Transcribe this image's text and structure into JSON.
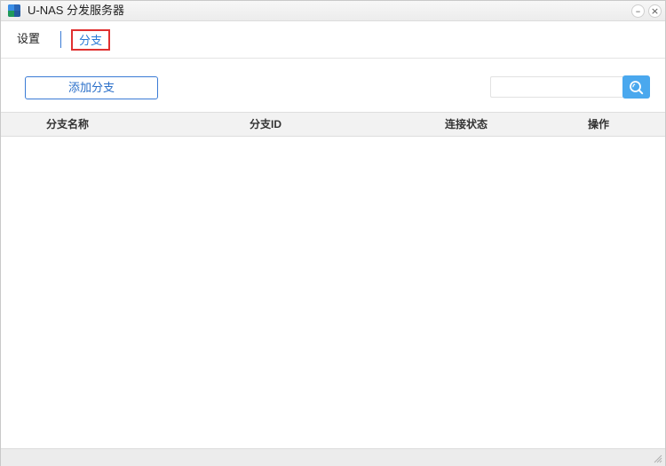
{
  "window": {
    "title": "U-NAS 分发服务器",
    "minimize_glyph": "–",
    "close_glyph": "×"
  },
  "tabs": [
    {
      "label": "设置",
      "active": false
    },
    {
      "label": "分支",
      "active": true
    }
  ],
  "toolbar": {
    "add_branch_label": "添加分支",
    "search": {
      "value": "",
      "placeholder": "",
      "icon": "search-icon"
    }
  },
  "table": {
    "columns": [
      "分支名称",
      "分支ID",
      "连接状态",
      "操作"
    ],
    "rows": []
  },
  "colors": {
    "accent": "#2a7ad6",
    "search_button": "#4aa8ee",
    "active_tab_border": "#e03030",
    "header_bg": "#f2f2f2"
  }
}
